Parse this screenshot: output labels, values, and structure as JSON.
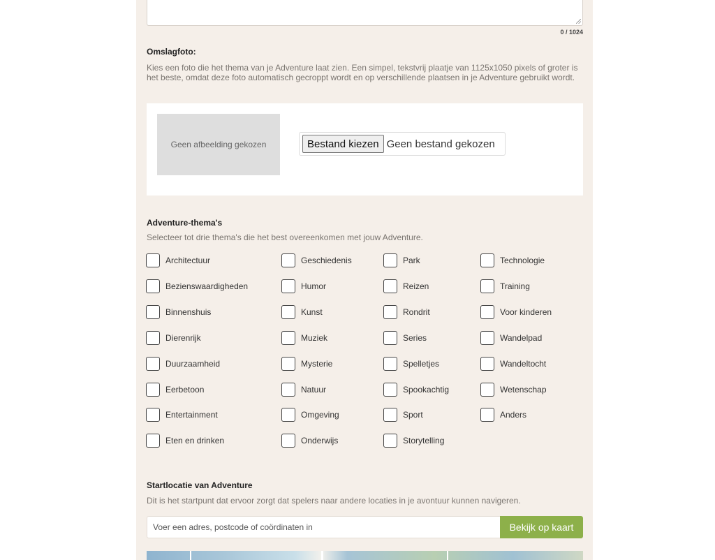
{
  "description": {
    "counter": "0 / 1024"
  },
  "cover_photo": {
    "title": "Omslagfoto:",
    "description": "Kies een foto die het thema van je Adventure laat zien. Een simpel, tekstvrij plaatje van 1125x1050 pixels of groter is het beste, omdat deze foto automatisch gecroppt wordt en op verschillende plaatsen in je Adventure gebruikt wordt.",
    "preview_text": "Geen afbeelding gekozen",
    "choose_button": "Bestand kiezen",
    "file_status": "Geen bestand gekozen"
  },
  "themes": {
    "title": "Adventure-thema's",
    "description": "Selecteer tot drie thema's die het best overeenkomen met jouw Adventure.",
    "columns": [
      [
        "Architectuur",
        "Bezienswaardigheden",
        "Binnenshuis",
        "Dierenrijk",
        "Duurzaamheid",
        "Eerbetoon",
        "Entertainment",
        "Eten en drinken"
      ],
      [
        "Geschiedenis",
        "Humor",
        "Kunst",
        "Muziek",
        "Mysterie",
        "Natuur",
        "Omgeving",
        "Onderwijs"
      ],
      [
        "Park",
        "Reizen",
        "Rondrit",
        "Series",
        "Spelletjes",
        "Spookachtig",
        "Sport",
        "Storytelling"
      ],
      [
        "Technologie",
        "Training",
        "Voor kinderen",
        "Wandelpad",
        "Wandeltocht",
        "Wetenschap",
        "Anders"
      ]
    ]
  },
  "start_location": {
    "title": "Startlocatie van Adventure",
    "description": "Dit is het startpunt dat ervoor zorgt dat spelers naar andere locaties in je avontuur kunnen navigeren.",
    "input_placeholder": "Voer een adres, postcode of coördinaten in",
    "map_button": "Bekijk op kaart"
  },
  "colors": {
    "panel_bg": "#f5efe9",
    "accent_green": "#8db04a"
  }
}
